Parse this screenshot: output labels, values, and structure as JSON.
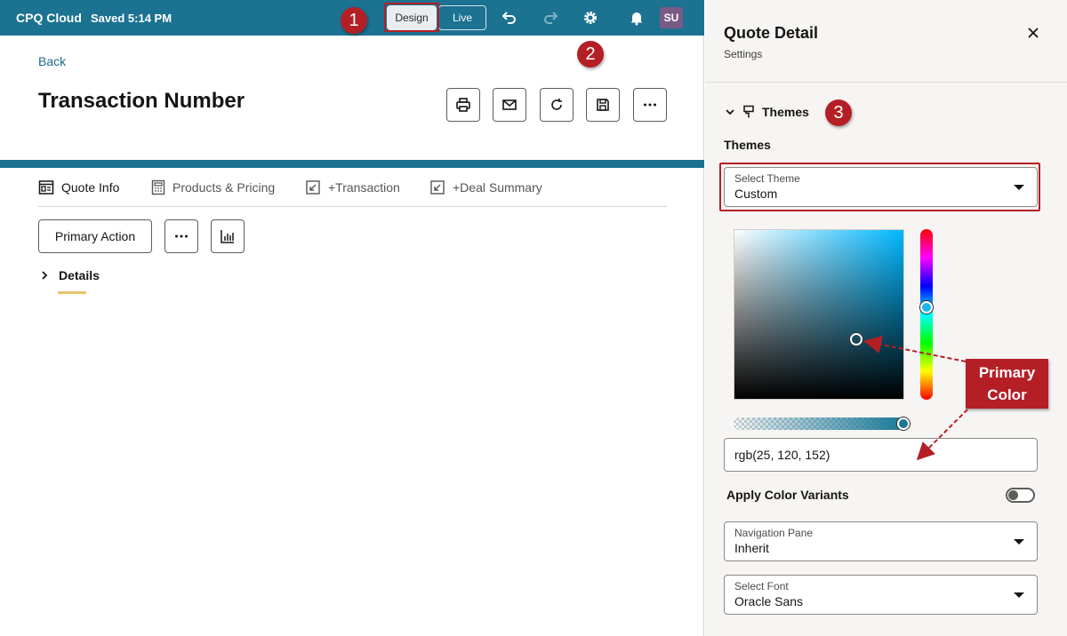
{
  "topbar": {
    "brand": "CPQ Cloud",
    "saved": "Saved 5:14 PM",
    "design_label": "Design",
    "live_label": "Live",
    "avatar": "SU",
    "colors": {
      "bar": "#1b7291"
    }
  },
  "page": {
    "back": "Back",
    "title": "Transaction Number"
  },
  "tabs": [
    {
      "label": "Quote Info",
      "icon": "form-icon"
    },
    {
      "label": "Products & Pricing",
      "icon": "calculator-icon"
    },
    {
      "label": "+Transaction",
      "icon": "external-link-icon"
    },
    {
      "label": "+Deal Summary",
      "icon": "external-link-icon"
    }
  ],
  "actions": {
    "primary": "Primary Action"
  },
  "details": {
    "label": "Details"
  },
  "panel": {
    "title": "Quote Detail",
    "subtitle": "Settings",
    "section": "Themes",
    "themes_label": "Themes",
    "select_theme": {
      "label": "Select Theme",
      "value": "Custom"
    },
    "rgb_value": "rgb(25, 120, 152)",
    "apply_variants": "Apply Color Variants",
    "apply_variants_on": false,
    "navigation_pane": {
      "label": "Navigation Pane",
      "value": "Inherit"
    },
    "select_font": {
      "label": "Select Font",
      "value": "Oracle Sans"
    }
  },
  "annotations": {
    "step1": "1",
    "step2": "2",
    "step3": "3",
    "primary_color_line1": "Primary",
    "primary_color_line2": "Color"
  }
}
